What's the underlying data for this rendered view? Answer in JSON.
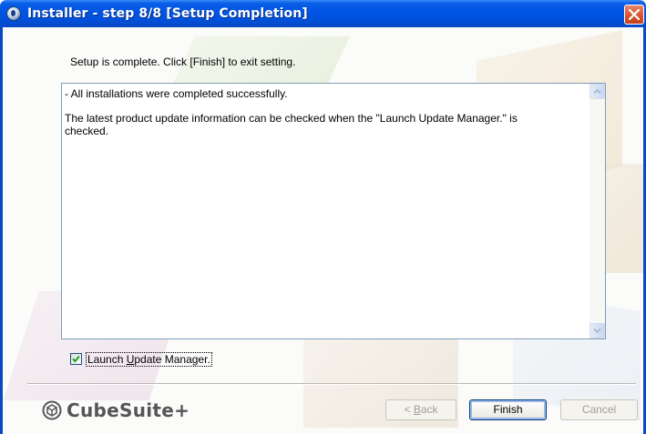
{
  "window": {
    "title": "Installer - step 8/8 [Setup Completion]"
  },
  "instruction": "Setup is complete. Click [Finish] to exit setting.",
  "log": {
    "line1": "- All installations were completed successfully.",
    "line2": "The latest product update information can be checked when the \"Launch Update Manager.\" is",
    "line3": "checked."
  },
  "checkbox": {
    "label_pre": "Launch ",
    "label_accel": "U",
    "label_post": "pdate Manager.",
    "checked": true
  },
  "logo": {
    "text": "CubeSuite+"
  },
  "buttons": {
    "back_pre": "< ",
    "back_accel": "B",
    "back_post": "ack",
    "finish": "Finish",
    "cancel": "Cancel"
  },
  "colors": {
    "titlebar": "#0054e3",
    "close": "#d9532d"
  }
}
